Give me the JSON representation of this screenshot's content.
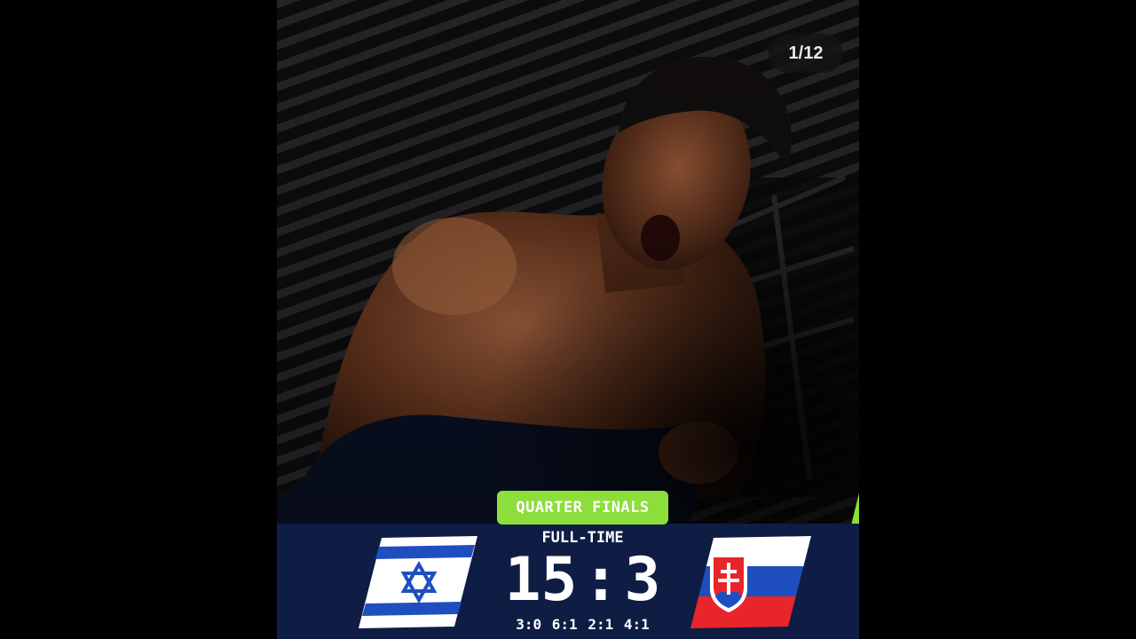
{
  "slide_counter": "1/12",
  "match": {
    "round": "QUARTER FINALS",
    "status": "FULL-TIME",
    "home_score": "15",
    "away_score": "3",
    "separator": ":",
    "quarter_scores": "3:0 6:1 2:1 4:1"
  },
  "teams": {
    "home": {
      "flag": "israel-flag"
    },
    "away": {
      "flag": "slovakia-flag"
    }
  },
  "colors": {
    "panel": "#0f1d45",
    "accent": "#8dde3a"
  }
}
